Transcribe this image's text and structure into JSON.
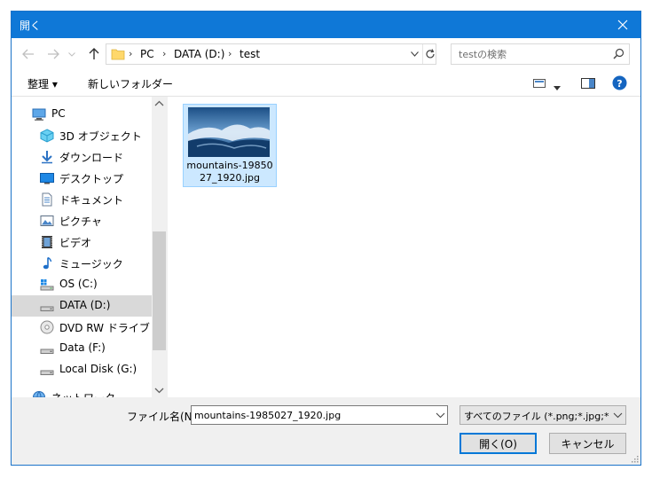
{
  "window": {
    "title": "開く"
  },
  "address": {
    "segments": [
      "PC",
      "DATA (D:)",
      "test"
    ]
  },
  "search": {
    "placeholder": "testの検索"
  },
  "toolbar": {
    "organize_label": "整理 ▾",
    "new_folder_label": "新しいフォルダー"
  },
  "sidebar": {
    "items": [
      {
        "label": "PC",
        "icon": "pc-icon"
      },
      {
        "label": "3D オブジェクト",
        "icon": "3d-objects-icon"
      },
      {
        "label": "ダウンロード",
        "icon": "download-icon"
      },
      {
        "label": "デスクトップ",
        "icon": "desktop-icon"
      },
      {
        "label": "ドキュメント",
        "icon": "documents-icon"
      },
      {
        "label": "ピクチャ",
        "icon": "pictures-icon"
      },
      {
        "label": "ビデオ",
        "icon": "videos-icon"
      },
      {
        "label": "ミュージック",
        "icon": "music-icon"
      },
      {
        "label": "OS (C:)",
        "icon": "os-drive-icon"
      },
      {
        "label": "DATA (D:)",
        "icon": "drive-icon",
        "selected": true
      },
      {
        "label": "DVD RW ドライブ (E:)",
        "icon": "dvd-drive-icon"
      },
      {
        "label": "Data (F:)",
        "icon": "drive-icon"
      },
      {
        "label": "Local Disk (G:)",
        "icon": "drive-icon"
      },
      {
        "label": "ネットワーク",
        "icon": "network-icon"
      }
    ]
  },
  "files": [
    {
      "name": "mountains-1985027_1920.jpg"
    }
  ],
  "bottom": {
    "filename_label": "ファイル名(N):",
    "filename_value": "mountains-1985027_1920.jpg",
    "filter_value": "すべてのファイル (*.png;*.jpg;*.jpe",
    "open_label": "開く(O)",
    "cancel_label": "キャンセル"
  },
  "colors": {
    "titlebar": "#0f78d7",
    "selection": "#cce8ff",
    "sidebar_selected": "#d9d9d9",
    "help": "#1565c0"
  }
}
